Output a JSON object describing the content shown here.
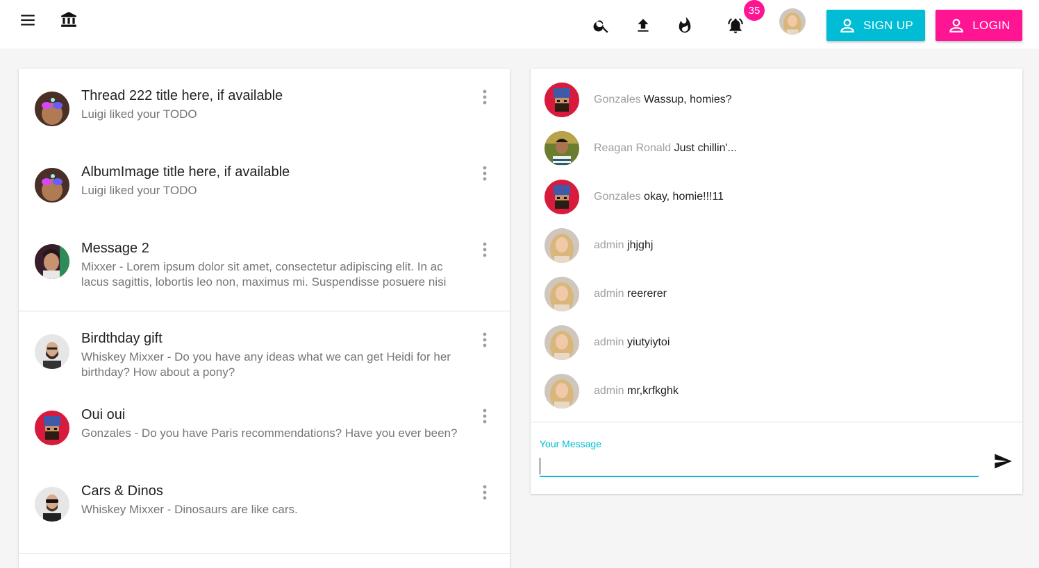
{
  "colors": {
    "accent_cyan": "#00bcd4",
    "accent_pink": "#ff1493"
  },
  "header": {
    "menu_icon": "menu-icon",
    "home_icon": "bank-icon",
    "icons": [
      "search-icon",
      "upload-icon",
      "flame-icon",
      "bell-icon"
    ],
    "notification_count": "35",
    "signup_label": "SIGN UP",
    "login_label": "LOGIN"
  },
  "notifications": [
    {
      "title": "Thread 222 title here, if available",
      "subtitle": "Luigi liked your TODO",
      "avatar": "neon-glasses-avatar"
    },
    {
      "title": "AlbumImage title here, if available",
      "subtitle": "Luigi liked your TODO",
      "avatar": "neon-glasses-avatar"
    },
    {
      "title": "Message 2",
      "subtitle": "Mixxer - Lorem ipsum dolor sit amet, consectetur adipiscing elit. In ac lacus sagittis, lobortis leo non, maximus mi. Suspendisse posuere nisi",
      "avatar": "kid-avatar"
    },
    {
      "title": "Birdthday gift",
      "subtitle": "Whiskey Mixxer - Do you have any ideas what we can get Heidi for her birthday? How about a pony?",
      "avatar": "bearded-man-avatar"
    },
    {
      "title": "Oui oui",
      "subtitle": "Gonzales - Do you have Paris recommendations? Have you ever been?",
      "avatar": "pixel-beanie-avatar"
    },
    {
      "title": "Cars & Dinos",
      "subtitle": "Whiskey Mixxer - Dinosaurs are like cars.",
      "avatar": "sunglasses-man-avatar"
    }
  ],
  "chat": {
    "messages": [
      {
        "author": "Gonzales",
        "text": "Wassup, homies?",
        "avatar": "pixel-beanie-avatar"
      },
      {
        "author": "Reagan Ronald",
        "text": "Just chillin'...",
        "avatar": "outdoor-man-avatar"
      },
      {
        "author": "Gonzales",
        "text": "okay, homie!!!11",
        "avatar": "pixel-beanie-avatar"
      },
      {
        "author": "admin",
        "text": "jhjghj",
        "avatar": "blonde-woman-avatar"
      },
      {
        "author": "admin",
        "text": "reererer",
        "avatar": "blonde-woman-avatar"
      },
      {
        "author": "admin",
        "text": "yiutyiytoi",
        "avatar": "blonde-woman-avatar"
      },
      {
        "author": "admin",
        "text": "mr,krfkghk",
        "avatar": "blonde-woman-avatar"
      }
    ],
    "input_label": "Your Message",
    "input_value": "",
    "send_icon": "send-icon"
  }
}
